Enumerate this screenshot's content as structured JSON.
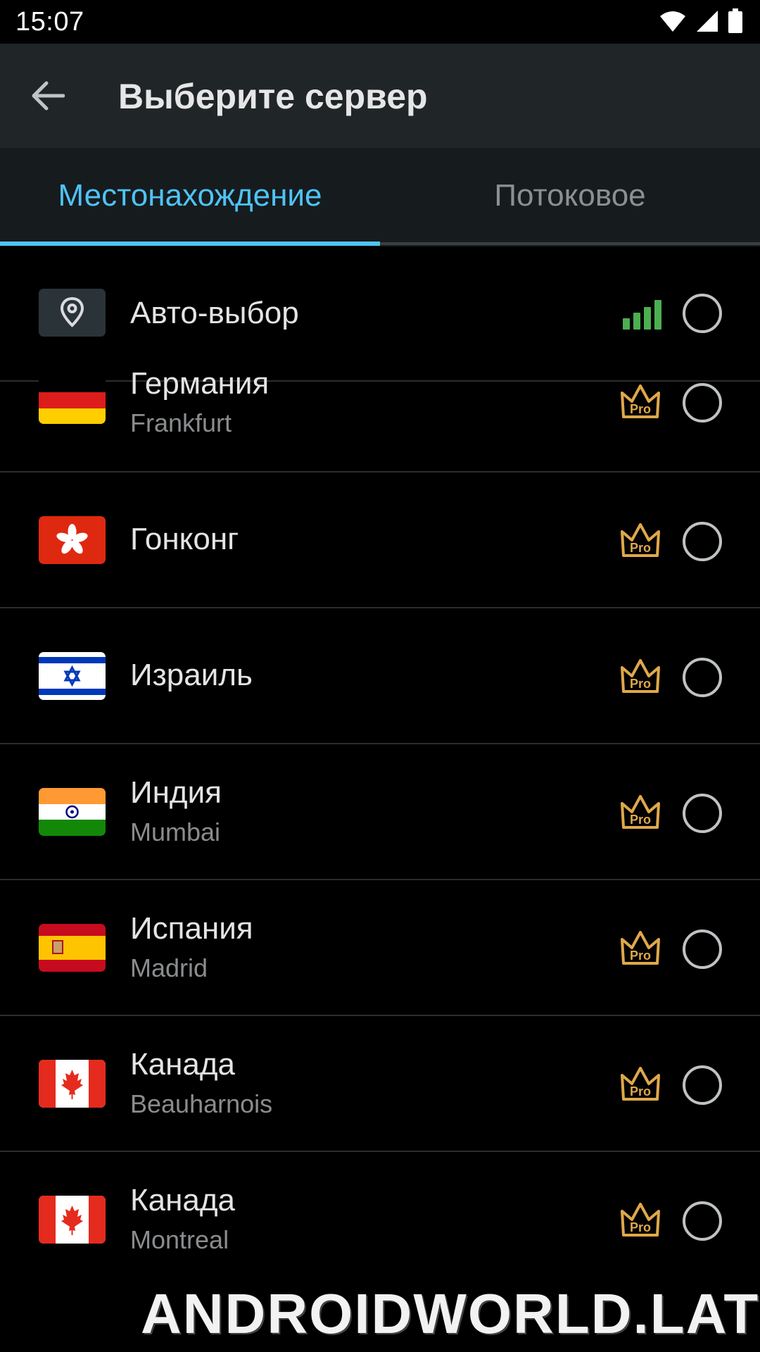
{
  "status_bar": {
    "time": "15:07"
  },
  "app_bar": {
    "title": "Выберите сервер"
  },
  "tabs": [
    {
      "label": "Местонахождение",
      "active": true
    },
    {
      "label": "Потоковое",
      "active": false
    }
  ],
  "colors": {
    "accent": "#4fc3f7",
    "signal": "#4caf50",
    "pro": "#e0a84a"
  },
  "servers": [
    {
      "title": "Авто-выбор",
      "subtitle": "",
      "icon": "location-pin-icon",
      "badge": "signal-strength-icon",
      "selected": false
    },
    {
      "title": "Германия",
      "subtitle": "Frankfurt",
      "icon": "flag-germany",
      "badge": "pro-crown-icon",
      "selected": false
    },
    {
      "title": "Гонконг",
      "subtitle": "",
      "icon": "flag-hong-kong",
      "badge": "pro-crown-icon",
      "selected": false
    },
    {
      "title": "Израиль",
      "subtitle": "",
      "icon": "flag-israel",
      "badge": "pro-crown-icon",
      "selected": false
    },
    {
      "title": "Индия",
      "subtitle": "Mumbai",
      "icon": "flag-india",
      "badge": "pro-crown-icon",
      "selected": false
    },
    {
      "title": "Испания",
      "subtitle": "Madrid",
      "icon": "flag-spain",
      "badge": "pro-crown-icon",
      "selected": false
    },
    {
      "title": "Канада",
      "subtitle": "Beauharnois",
      "icon": "flag-canada",
      "badge": "pro-crown-icon",
      "selected": false
    },
    {
      "title": "Канада",
      "subtitle": "Montreal",
      "icon": "flag-canada",
      "badge": "pro-crown-icon",
      "selected": false
    }
  ],
  "pro_label": "Pro",
  "watermark": "ANDROIDWORLD.LAT"
}
